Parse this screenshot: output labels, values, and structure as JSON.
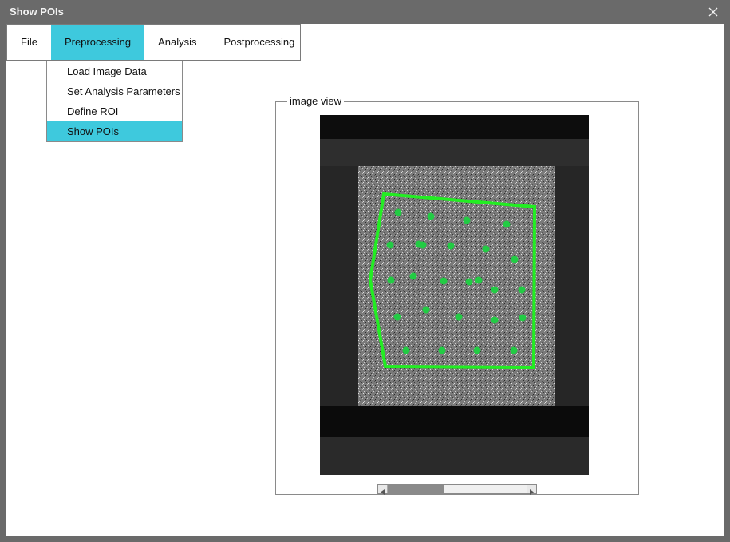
{
  "window": {
    "title": "Show POIs",
    "close_icon": "close-icon"
  },
  "menu": {
    "items": [
      {
        "label": "File"
      },
      {
        "label": "Preprocessing"
      },
      {
        "label": "Analysis"
      },
      {
        "label": "Postprocessing"
      }
    ],
    "active_index": 1
  },
  "dropdown": {
    "items": [
      {
        "label": "Load Image Data"
      },
      {
        "label": "Set Analysis Parameters"
      },
      {
        "label": "Define ROI"
      },
      {
        "label": "Show POIs"
      }
    ],
    "active_index": 3
  },
  "image_view": {
    "legend": "image view",
    "roi_color": "#22ee22",
    "poi_color": "#22cc44",
    "poi_count": 29
  },
  "colors": {
    "accent": "#3ec9dd",
    "titlebar": "#6a6a6a"
  }
}
